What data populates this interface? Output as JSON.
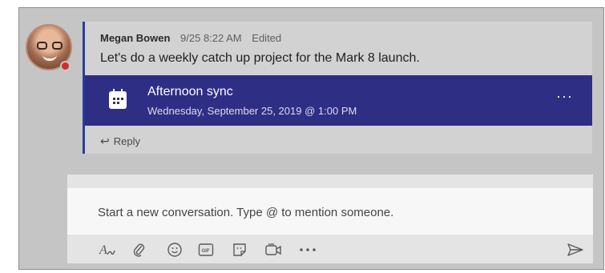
{
  "message": {
    "author": "Megan Bowen",
    "timestamp": "9/25 8:22 AM",
    "edited_label": "Edited",
    "body": "Let's do a weekly catch up project for the Mark 8 launch.",
    "presence_status_color": "#d52b2b"
  },
  "meeting_card": {
    "title": "Afternoon sync",
    "datetime": "Wednesday, September 25, 2019 @ 1:00 PM",
    "more_label": "···",
    "icon": "calendar-icon",
    "background_color": "#2e2e85"
  },
  "reply": {
    "icon": "reply-arrow-icon",
    "arrow_glyph": "↩",
    "label": "Reply"
  },
  "compose": {
    "placeholder": "Start a new conversation. Type @ to mention someone.",
    "toolbar": [
      {
        "icon": "format-icon",
        "glyph": "A"
      },
      {
        "icon": "attach-icon"
      },
      {
        "icon": "emoji-icon"
      },
      {
        "icon": "gif-icon",
        "glyph": "GIF"
      },
      {
        "icon": "sticker-icon"
      },
      {
        "icon": "meet-now-icon"
      },
      {
        "icon": "more-options-icon",
        "glyph": "···"
      },
      {
        "icon": "send-icon"
      }
    ]
  },
  "colors": {
    "accent": "#2b3b9b",
    "background": "#c5c5c5"
  }
}
